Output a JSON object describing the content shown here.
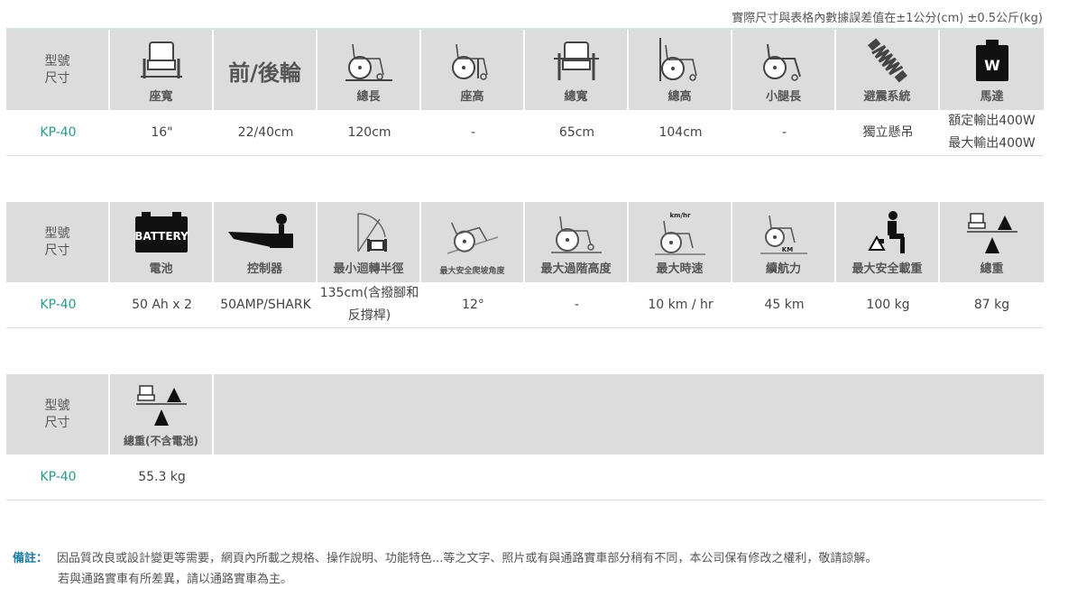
{
  "top_note": "實際尺寸與表格內數據誤差值在±1公分(cm) ±0.5公斤(kg)",
  "row_label": [
    "型號",
    "尺寸"
  ],
  "model": "KP-40",
  "table1": {
    "headers": [
      {
        "icon": "seat-width-icon",
        "label": "座寬"
      },
      {
        "icon": "wheel-text",
        "label": "前/後輪"
      },
      {
        "icon": "total-length-icon",
        "label": "總長"
      },
      {
        "icon": "seat-height-icon",
        "label": "座高"
      },
      {
        "icon": "total-width-icon",
        "label": "總寬"
      },
      {
        "icon": "total-height-icon",
        "label": "總高"
      },
      {
        "icon": "calf-length-icon",
        "label": "小腿長"
      },
      {
        "icon": "shock-absorber-icon",
        "label": "避震系統"
      },
      {
        "icon": "motor-weight-icon",
        "label": "馬達",
        "icon_text": "W"
      }
    ],
    "values": [
      "16\"",
      "22/40cm",
      "120cm",
      "-",
      "65cm",
      "104cm",
      "-",
      "獨立懸吊",
      "額定輸出400W",
      "最大輸出400W"
    ]
  },
  "table2": {
    "headers": [
      {
        "icon": "battery-icon",
        "label": "電池",
        "icon_text": "BATTERY"
      },
      {
        "icon": "controller-joystick-icon",
        "label": "控制器"
      },
      {
        "icon": "turning-radius-icon",
        "label": "最小迴轉半徑"
      },
      {
        "icon": "climb-angle-icon",
        "label": "最大安全爬坡角度"
      },
      {
        "icon": "step-height-icon",
        "label": "最大過階高度"
      },
      {
        "icon": "speed-icon",
        "label": "最大時速",
        "icon_text": "km/hr"
      },
      {
        "icon": "range-icon",
        "label": "續航力",
        "icon_text": "KM"
      },
      {
        "icon": "load-capacity-icon",
        "label": "最大安全載重"
      },
      {
        "icon": "total-weight-icon",
        "label": "總重"
      }
    ],
    "values": [
      "50 Ah x 2",
      "50AMP/SHARK",
      "135cm(含撥腳和反撐桿)",
      "12°",
      "-",
      "10 km / hr",
      "45 km",
      "100 kg",
      "87 kg"
    ]
  },
  "table3": {
    "headers": [
      {
        "icon": "weight-no-battery-icon",
        "label": "總重(不含電池)"
      }
    ],
    "values": [
      "55.3 kg"
    ]
  },
  "remark": {
    "label": "備註：",
    "line1": "因品質改良或設計變更等需要，網頁內所載之規格、操作說明、功能特色...等之文字、照片或有與通路實車部分稍有不同，本公司保有修改之權利，敬請諒解。",
    "line2": "若與通路實車有所差異，請以通路實車為主。"
  }
}
